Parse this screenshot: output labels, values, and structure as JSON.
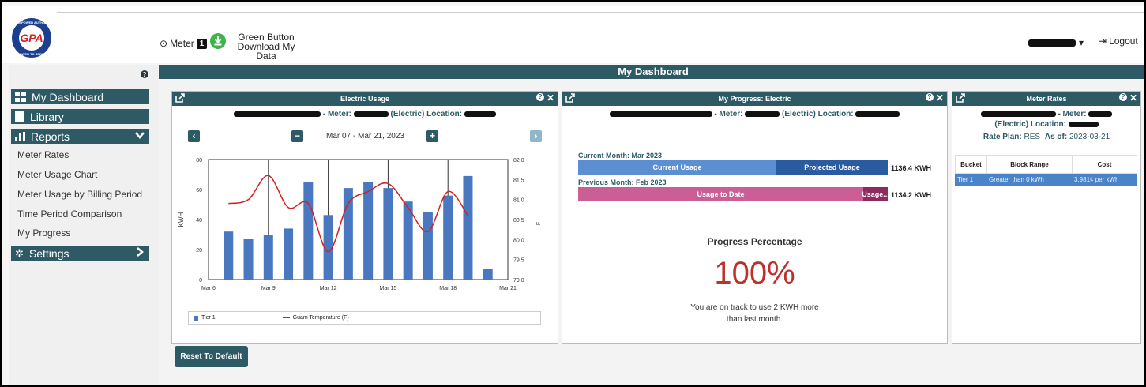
{
  "header": {
    "logo_text": "GPA",
    "logo_ring_text": "GUAM POWER AUTHORITY · POWER TO SERVE",
    "meter_label": "Meter",
    "meter_number": "1",
    "green_button_line1": "Green Button",
    "green_button_line2": "Download My Data",
    "user_caret": "▾",
    "logout_label": "Logout"
  },
  "sidebar": {
    "items": [
      {
        "label": "My Dashboard",
        "icon": "grid-icon"
      },
      {
        "label": "Library",
        "icon": "book-icon"
      },
      {
        "label": "Reports",
        "icon": "bar-chart-icon"
      },
      {
        "label": "Settings",
        "icon": "gear-icon"
      }
    ],
    "reports_sub": [
      "Meter Rates",
      "Meter Usage Chart",
      "Meter Usage by Billing Period",
      "Time Period Comparison",
      "My Progress"
    ]
  },
  "main": {
    "title": "My Dashboard",
    "reset_label": "Reset To Default"
  },
  "usage_widget": {
    "title": "Electric Usage",
    "meter_text": "- Meter:",
    "electric_location": "(Electric) Location:",
    "date_range": "Mar 07 - Mar 21, 2023",
    "left_axis_label": "KWH",
    "right_axis_label": "F"
  },
  "progress_widget": {
    "title": "My Progress: Electric",
    "meter_text": "- Meter:",
    "electric_location": "(Electric) Location:",
    "current_month_label": "Current Month: Mar 2023",
    "current_usage_label": "Current Usage",
    "projected_usage_label": "Projected Usage",
    "current_value": "1136.4 KWH",
    "previous_month_label": "Previous Month: Feb 2023",
    "usage_to_date_label": "Usage to Date",
    "usage_short_label": "Usage...",
    "previous_value": "1134.2 KWH",
    "current_fraction": 0.64,
    "previous_fraction": 0.92,
    "progress_title": "Progress Percentage",
    "progress_percent": "100%",
    "message_line1": "You are on track to use 2 KWH more",
    "message_line2": "than last month."
  },
  "rates_widget": {
    "title": "Meter Rates",
    "meter_text": "- Meter:",
    "electric_location": "(Electric) Location:",
    "rate_plan_label": "Rate Plan:",
    "rate_plan_value": "RES",
    "as_of_label": "As of:",
    "as_of_value": "2023-03-21",
    "columns": [
      "Bucket",
      "Block Range",
      "Cost"
    ],
    "rows": [
      [
        "Tier 1",
        "Greater than 0 kWh",
        "3.981¢ per kWh"
      ]
    ]
  },
  "chart_data": {
    "type": "bar",
    "x_ticks": [
      "Mar 6",
      "Mar 9",
      "Mar 12",
      "Mar 15",
      "Mar 18",
      "Mar 21"
    ],
    "y_ticks": [
      "0",
      "20",
      "40",
      "60",
      "80"
    ],
    "y2_ticks": [
      "79.0",
      "79.5",
      "80.0",
      "80.5",
      "81.0",
      "81.5",
      "82.0"
    ],
    "ylabel": "KWH",
    "y2label": "F",
    "ylim": [
      0,
      80
    ],
    "y2lim": [
      79.0,
      82.0
    ],
    "xlim": [
      "2023-03-06",
      "2023-03-21"
    ],
    "grid": true,
    "legend_position": "bottom",
    "colors": {
      "bars": "#4a78c0",
      "line": "#d42020"
    },
    "series": [
      {
        "name": "Tier 1",
        "type": "bar",
        "axis": "left",
        "x": [
          "2023-03-07",
          "2023-03-08",
          "2023-03-09",
          "2023-03-10",
          "2023-03-11",
          "2023-03-12",
          "2023-03-13",
          "2023-03-14",
          "2023-03-15",
          "2023-03-16",
          "2023-03-17",
          "2023-03-18",
          "2023-03-19",
          "2023-03-20"
        ],
        "values": [
          32,
          27,
          30,
          34,
          65,
          43,
          61,
          65,
          61,
          52,
          45,
          56,
          69,
          7
        ]
      },
      {
        "name": "Guam Temperature (F)",
        "type": "line",
        "axis": "right",
        "x": [
          "2023-03-07",
          "2023-03-08",
          "2023-03-09",
          "2023-03-10",
          "2023-03-11",
          "2023-03-12",
          "2023-03-13",
          "2023-03-14",
          "2023-03-15",
          "2023-03-16",
          "2023-03-17",
          "2023-03-18",
          "2023-03-19"
        ],
        "values": [
          80.9,
          81.0,
          81.6,
          80.8,
          80.9,
          79.7,
          80.9,
          81.2,
          81.4,
          80.8,
          80.2,
          81.2,
          80.6
        ]
      }
    ]
  }
}
